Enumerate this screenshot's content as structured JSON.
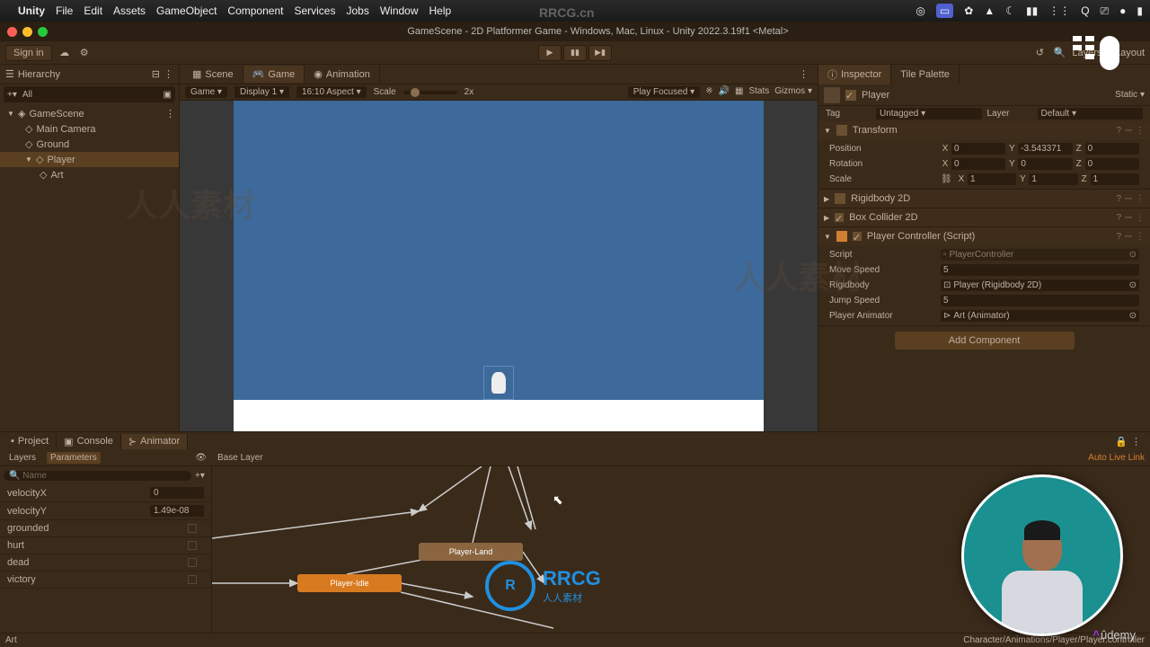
{
  "menubar": {
    "apple": "",
    "app_name": "Unity",
    "menus": [
      "File",
      "Edit",
      "Assets",
      "GameObject",
      "Component",
      "Services",
      "Jobs",
      "Window",
      "Help"
    ]
  },
  "window": {
    "title": "GameScene - 2D Platformer Game - Windows, Mac, Linux - Unity 2022.3.19f1 <Metal>"
  },
  "toolbar": {
    "sign_in": "Sign in",
    "layout": "Layout"
  },
  "hierarchy": {
    "title": "Hierarchy",
    "search_placeholder": "All",
    "scene": "GameScene",
    "items": [
      "Main Camera",
      "Ground",
      "Player",
      "Art"
    ]
  },
  "center_tabs": {
    "scene": "Scene",
    "game": "Game",
    "animation": "Animation"
  },
  "game_bar": {
    "mode": "Game",
    "display": "Display 1",
    "aspect": "16:10 Aspect",
    "scale_label": "Scale",
    "scale_value": "2x",
    "play_focused": "Play Focused",
    "stats": "Stats",
    "gizmos": "Gizmos"
  },
  "inspector": {
    "tab_inspector": "Inspector",
    "tab_tile": "Tile Palette",
    "object_name": "Player",
    "static": "Static",
    "tag_label": "Tag",
    "tag_value": "Untagged",
    "layer_label": "Layer",
    "layer_value": "Default",
    "transform": {
      "title": "Transform",
      "position": "Position",
      "rotation": "Rotation",
      "scale": "Scale",
      "pos": {
        "x": "0",
        "y": "-3.543371",
        "z": "0"
      },
      "rot": {
        "x": "0",
        "y": "0",
        "z": "0"
      },
      "scl": {
        "x": "1",
        "y": "1",
        "z": "1"
      }
    },
    "rigidbody": {
      "title": "Rigidbody 2D"
    },
    "boxcollider": {
      "title": "Box Collider 2D"
    },
    "player_controller": {
      "title": "Player Controller (Script)",
      "script_label": "Script",
      "script_value": "PlayerController",
      "move_speed_label": "Move Speed",
      "move_speed_value": "5",
      "rigidbody_label": "Rigidbody",
      "rigidbody_value": "Player (Rigidbody 2D)",
      "jump_speed_label": "Jump Speed",
      "jump_speed_value": "5",
      "animator_label": "Player Animator",
      "animator_value": "Art (Animator)"
    },
    "add_component": "Add Component"
  },
  "bottom": {
    "tab_project": "Project",
    "tab_console": "Console",
    "tab_animator": "Animator",
    "layers": "Layers",
    "parameters": "Parameters",
    "base_layer": "Base Layer",
    "auto_live_link": "Auto Live Link",
    "name_placeholder": "Name",
    "params": [
      {
        "name": "velocityX",
        "value": "0",
        "type": "float"
      },
      {
        "name": "velocityY",
        "value": "1.49e-08",
        "type": "float"
      },
      {
        "name": "grounded",
        "value": "",
        "type": "bool"
      },
      {
        "name": "hurt",
        "value": "",
        "type": "bool"
      },
      {
        "name": "dead",
        "value": "",
        "type": "bool"
      },
      {
        "name": "victory",
        "value": "",
        "type": "bool"
      }
    ],
    "state_idle": "Player-Idle",
    "state_land": "Player-Land",
    "footer_left": "Art",
    "footer_right": "Character/Animations/Player/Player.controller"
  },
  "watermarks": {
    "wm": "人人素材",
    "url": "RRCG.cn",
    "rrcg": "RRCG",
    "rrcg_sub": "人人素材",
    "udemy": "ûdemy"
  }
}
